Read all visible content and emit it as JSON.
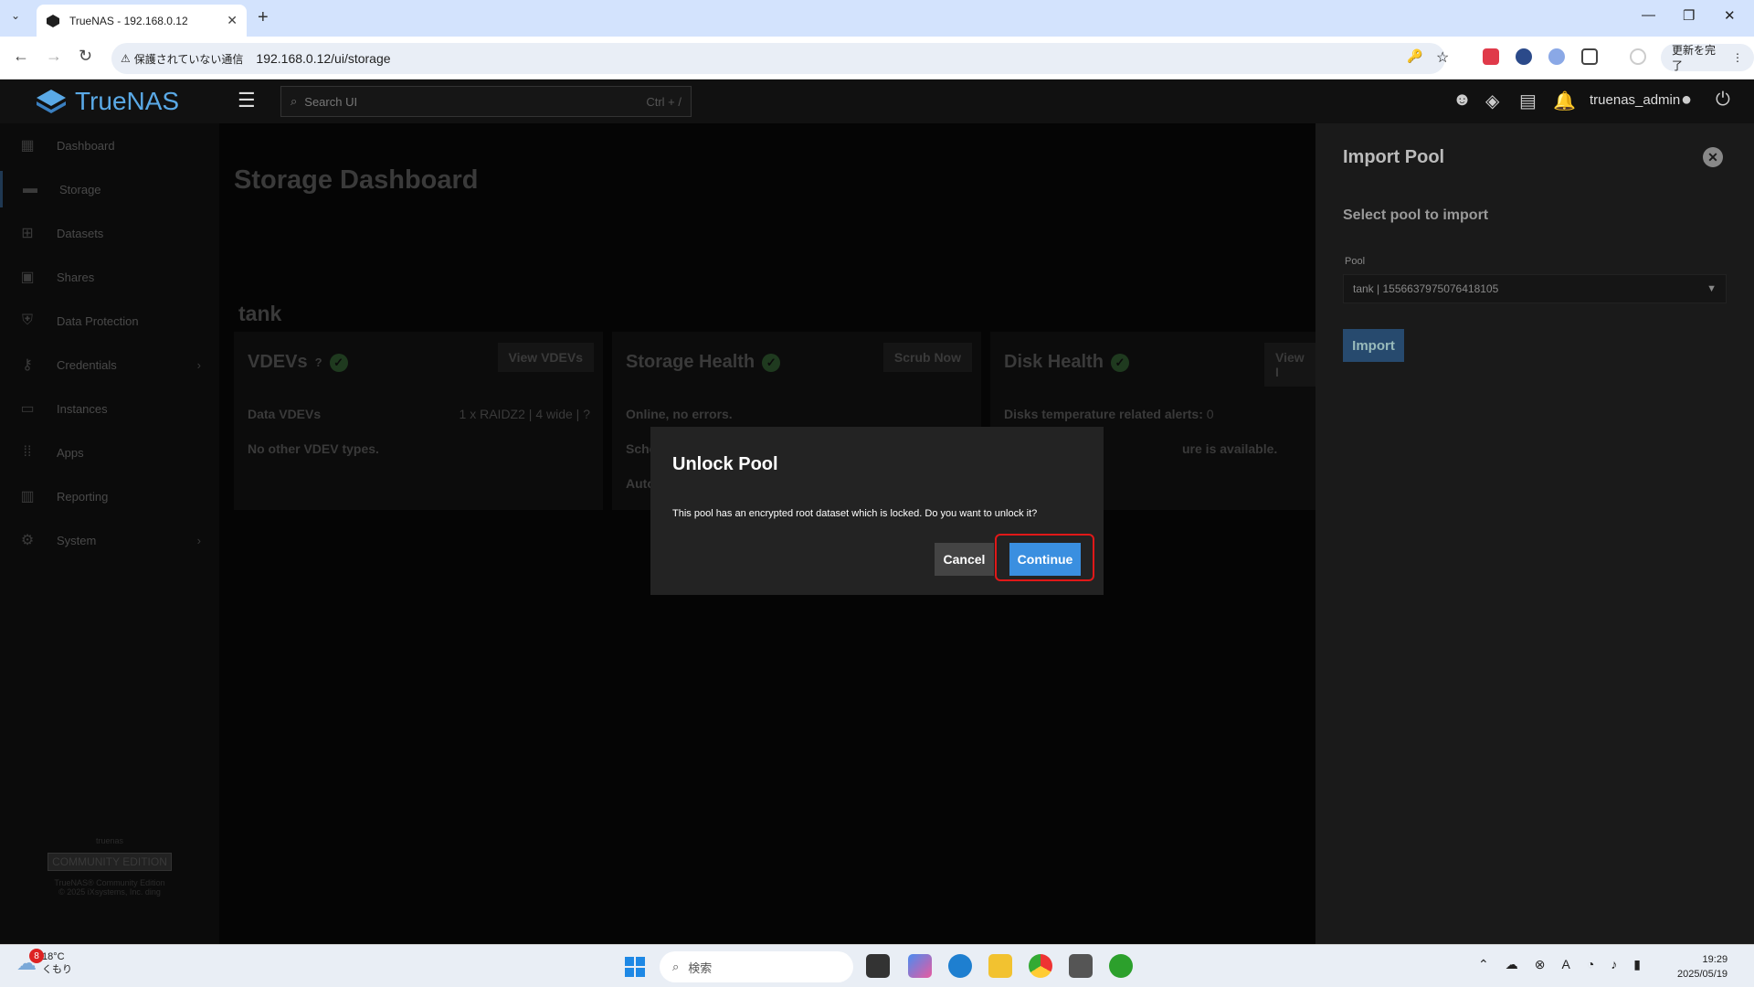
{
  "browser": {
    "tab_title": "TrueNAS - 192.168.0.12",
    "url": "192.168.0.12/ui/storage",
    "security_label": "保護されていない通信",
    "update_label": "更新を完了"
  },
  "header": {
    "brand": "TrueNAS",
    "search_placeholder": "Search UI",
    "search_shortcut": "Ctrl + /",
    "username": "truenas_admin"
  },
  "sidebar": {
    "items": [
      {
        "label": "Dashboard",
        "icon": "dashboard-icon"
      },
      {
        "label": "Storage",
        "icon": "storage-icon"
      },
      {
        "label": "Datasets",
        "icon": "datasets-icon"
      },
      {
        "label": "Shares",
        "icon": "shares-icon"
      },
      {
        "label": "Data Protection",
        "icon": "shield-icon"
      },
      {
        "label": "Credentials",
        "icon": "key-icon"
      },
      {
        "label": "Instances",
        "icon": "laptop-icon"
      },
      {
        "label": "Apps",
        "icon": "apps-grid-icon"
      },
      {
        "label": "Reporting",
        "icon": "chart-icon"
      },
      {
        "label": "System",
        "icon": "gear-icon"
      }
    ],
    "footer_brand": "truenas",
    "footer_edition": "COMMUNITY EDITION",
    "footer_line1": "TrueNAS® Community Edition",
    "footer_line2": "© 2025 iXsystems, Inc. ding"
  },
  "main": {
    "title": "Storage Dashboard",
    "pool_name": "tank",
    "cards": {
      "vdevs": {
        "title": "VDEVs",
        "button": "View VDEVs",
        "data_label": "Data VDEVs",
        "data_value": "1 x RAIDZ2 | 4 wide | ?",
        "other": "No other VDEV types."
      },
      "health": {
        "title": "Storage Health",
        "button": "Scrub Now",
        "status": "Online, no errors.",
        "line2": "Sche",
        "line3": "Auto"
      },
      "disk": {
        "title": "Disk Health",
        "button": "View I",
        "alerts_label": "Disks temperature related alerts:",
        "alerts_value": "0",
        "line2": "ure is available."
      }
    }
  },
  "panel": {
    "title": "Import Pool",
    "subtitle": "Select pool to import",
    "pool_label": "Pool",
    "pool_value": "tank | 1556637975076418105",
    "import_label": "Import"
  },
  "dialog": {
    "title": "Unlock Pool",
    "message": "This pool has an encrypted root dataset which is locked. Do you want to unlock it?",
    "cancel_label": "Cancel",
    "continue_label": "Continue"
  },
  "taskbar": {
    "temperature": "18°C",
    "weather": "くもり",
    "notification_count": "8",
    "search_placeholder": "検索",
    "time": "19:29",
    "date": "2025/05/19"
  }
}
